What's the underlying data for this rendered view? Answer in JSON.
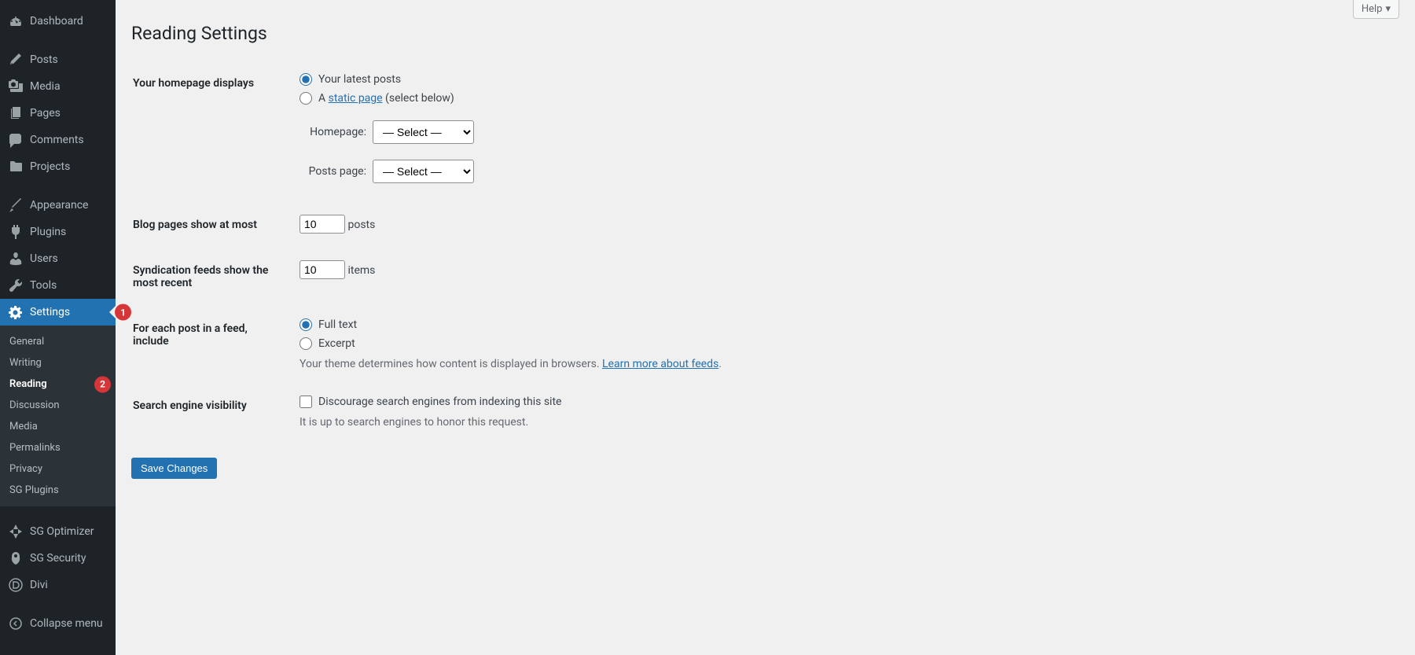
{
  "help": "Help",
  "sidebar": {
    "dashboard": "Dashboard",
    "posts": "Posts",
    "media": "Media",
    "pages": "Pages",
    "comments": "Comments",
    "projects": "Projects",
    "appearance": "Appearance",
    "plugins": "Plugins",
    "users": "Users",
    "tools": "Tools",
    "settings": "Settings",
    "sg_optimizer": "SG Optimizer",
    "sg_security": "SG Security",
    "divi": "Divi",
    "collapse": "Collapse menu"
  },
  "submenu": {
    "general": "General",
    "writing": "Writing",
    "reading": "Reading",
    "discussion": "Discussion",
    "media": "Media",
    "permalinks": "Permalinks",
    "privacy": "Privacy",
    "sg_plugins": "SG Plugins"
  },
  "badges": {
    "settings": "1",
    "reading": "2"
  },
  "page": {
    "title": "Reading Settings",
    "homepage_label": "Your homepage displays",
    "radio_latest": "Your latest posts",
    "radio_static_prefix": "A ",
    "radio_static_link": "static page",
    "radio_static_suffix": " (select below)",
    "homepage_select_label": "Homepage:",
    "postspage_select_label": "Posts page:",
    "select_placeholder": "— Select —",
    "blog_pages_label": "Blog pages show at most",
    "blog_pages_value": "10",
    "posts_suffix": "posts",
    "syndication_label": "Syndication feeds show the most recent",
    "syndication_value": "10",
    "items_suffix": "items",
    "feed_include_label": "For each post in a feed, include",
    "radio_fulltext": "Full text",
    "radio_excerpt": "Excerpt",
    "feed_desc_prefix": "Your theme determines how content is displayed in browsers. ",
    "feed_desc_link": "Learn more about feeds",
    "feed_desc_suffix": ".",
    "search_label": "Search engine visibility",
    "discourage_label": "Discourage search engines from indexing this site",
    "discourage_desc": "It is up to search engines to honor this request.",
    "save": "Save Changes"
  }
}
